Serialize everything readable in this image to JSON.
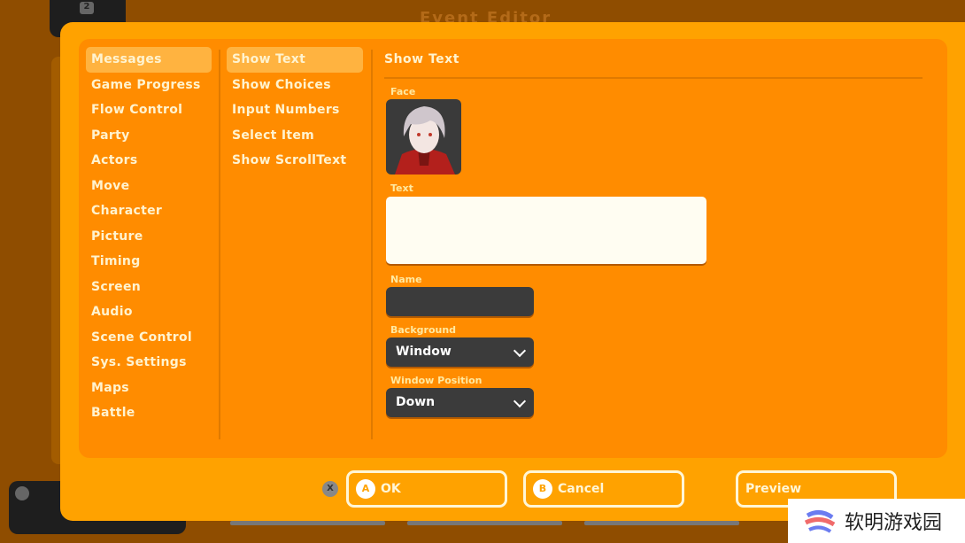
{
  "window": {
    "title": "Event Editor"
  },
  "categories": [
    "Messages",
    "Game Progress",
    "Flow Control",
    "Party",
    "Actors",
    "Move",
    "Character",
    "Picture",
    "Timing",
    "Screen",
    "Audio",
    "Scene Control",
    "Sys. Settings",
    "Maps",
    "Battle"
  ],
  "commands": [
    "Show Text",
    "Show Choices",
    "Input Numbers",
    "Select Item",
    "Show ScrollText"
  ],
  "detail": {
    "title": "Show Text",
    "face_label": "Face",
    "text_label": "Text",
    "text_value": "",
    "name_label": "Name",
    "name_value": "",
    "background_label": "Background",
    "background_value": "Window",
    "position_label": "Window Position",
    "position_value": "Down"
  },
  "footer": {
    "x_key": "X",
    "ok_key": "A",
    "ok": "OK",
    "cancel_key": "B",
    "cancel": "Cancel",
    "preview": "Preview"
  },
  "watermark": "软明游戏园",
  "colors": {
    "dialog": "#ffa200",
    "panel": "#ff8c00",
    "selected": "#ffb340",
    "background": "#8f4d00"
  }
}
